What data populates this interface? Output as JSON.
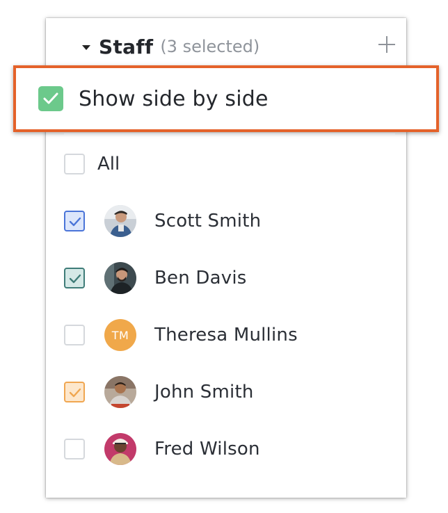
{
  "staff": {
    "title": "Staff",
    "selected_count": "(3 selected)",
    "show_side_by_side": {
      "label": "Show side by side",
      "checked": true,
      "color": "#6cc98b"
    },
    "highlight_color": "#e4622a",
    "all": {
      "label": "All",
      "checked": false
    },
    "members": [
      {
        "name": "Scott Smith",
        "checked": true,
        "color": "#4a74d8",
        "avatar": "photo"
      },
      {
        "name": "Ben Davis",
        "checked": true,
        "color": "#3e7c78",
        "avatar": "photo"
      },
      {
        "name": "Theresa Mullins",
        "checked": false,
        "initials": "TM",
        "avatar": "initials",
        "avatar_color": "#f0a84a"
      },
      {
        "name": "John Smith",
        "checked": true,
        "color": "#f0a650",
        "avatar": "photo"
      },
      {
        "name": "Fred Wilson",
        "checked": false,
        "avatar": "photo"
      }
    ]
  }
}
